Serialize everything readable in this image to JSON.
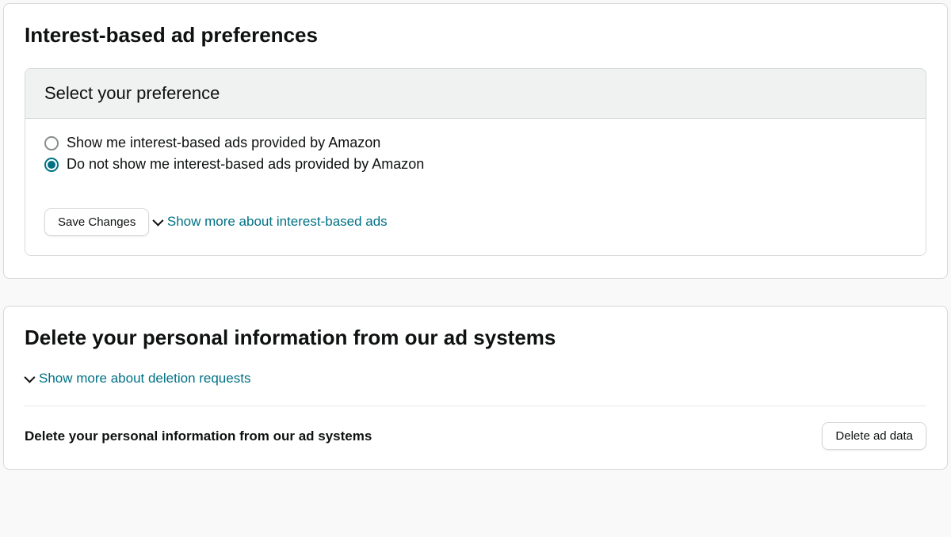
{
  "section1": {
    "heading": "Interest-based ad preferences",
    "panel_title": "Select your preference",
    "options": [
      {
        "label": "Show me interest-based ads provided by Amazon",
        "selected": false
      },
      {
        "label": "Do not show me interest-based ads provided by Amazon",
        "selected": true
      }
    ],
    "save_button": "Save Changes",
    "expander": "Show more about interest-based ads"
  },
  "section2": {
    "heading": "Delete your personal information from our ad systems",
    "expander": "Show more about deletion requests",
    "delete_label": "Delete your personal information from our ad systems",
    "delete_button": "Delete ad data"
  }
}
